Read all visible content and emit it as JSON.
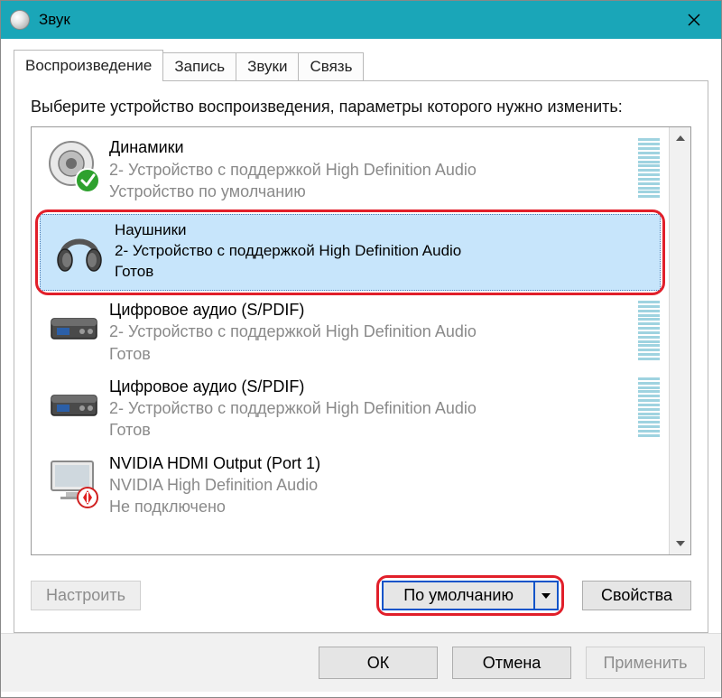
{
  "window": {
    "title": "Звук"
  },
  "tabs": {
    "playback": "Воспроизведение",
    "recording": "Запись",
    "sounds": "Звуки",
    "communications": "Связь"
  },
  "instruction": "Выберите устройство воспроизведения, параметры которого нужно изменить:",
  "devices": [
    {
      "name": "Динамики",
      "desc": "2- Устройство с поддержкой High Definition Audio",
      "status": "Устройство по умолчанию"
    },
    {
      "name": "Наушники",
      "desc": "2- Устройство с поддержкой High Definition Audio",
      "status": "Готов"
    },
    {
      "name": "Цифровое аудио (S/PDIF)",
      "desc": "2- Устройство с поддержкой High Definition Audio",
      "status": "Готов"
    },
    {
      "name": "Цифровое аудио (S/PDIF)",
      "desc": "2- Устройство с поддержкой High Definition Audio",
      "status": "Готов"
    },
    {
      "name": "NVIDIA HDMI Output (Port 1)",
      "desc": "NVIDIA High Definition Audio",
      "status": "Не подключено"
    }
  ],
  "actions": {
    "configure": "Настроить",
    "set_default": "По умолчанию",
    "properties": "Свойства"
  },
  "dialog": {
    "ok": "ОК",
    "cancel": "Отмена",
    "apply": "Применить"
  }
}
